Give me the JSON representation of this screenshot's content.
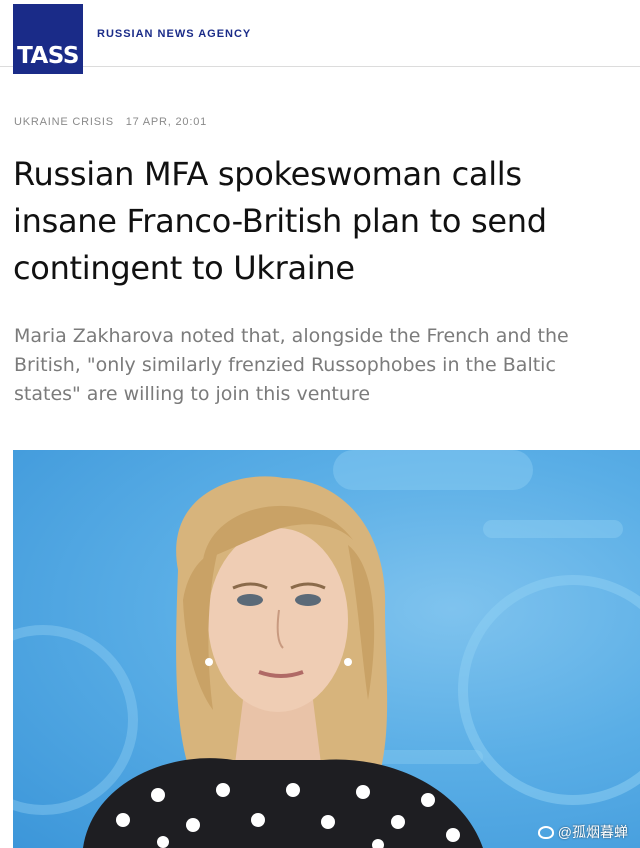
{
  "brand": {
    "logo_text": "TASS",
    "agency_name": "RUSSIAN NEWS AGENCY",
    "logo_color": "#1a2b88"
  },
  "article": {
    "category": "UKRAINE CRISIS",
    "timestamp": "17 APR, 20:01",
    "headline": "Russian MFA spokeswoman calls insane Franco-British plan to send contingent to Ukraine",
    "lead": "Maria Zakharova noted that, alongside the French and the British, \"only similarly frenzied Russophobes in the Baltic states\" are willing to join this venture"
  },
  "watermark": {
    "icon": "weibo-icon",
    "text": "@孤烟暮蝉"
  }
}
